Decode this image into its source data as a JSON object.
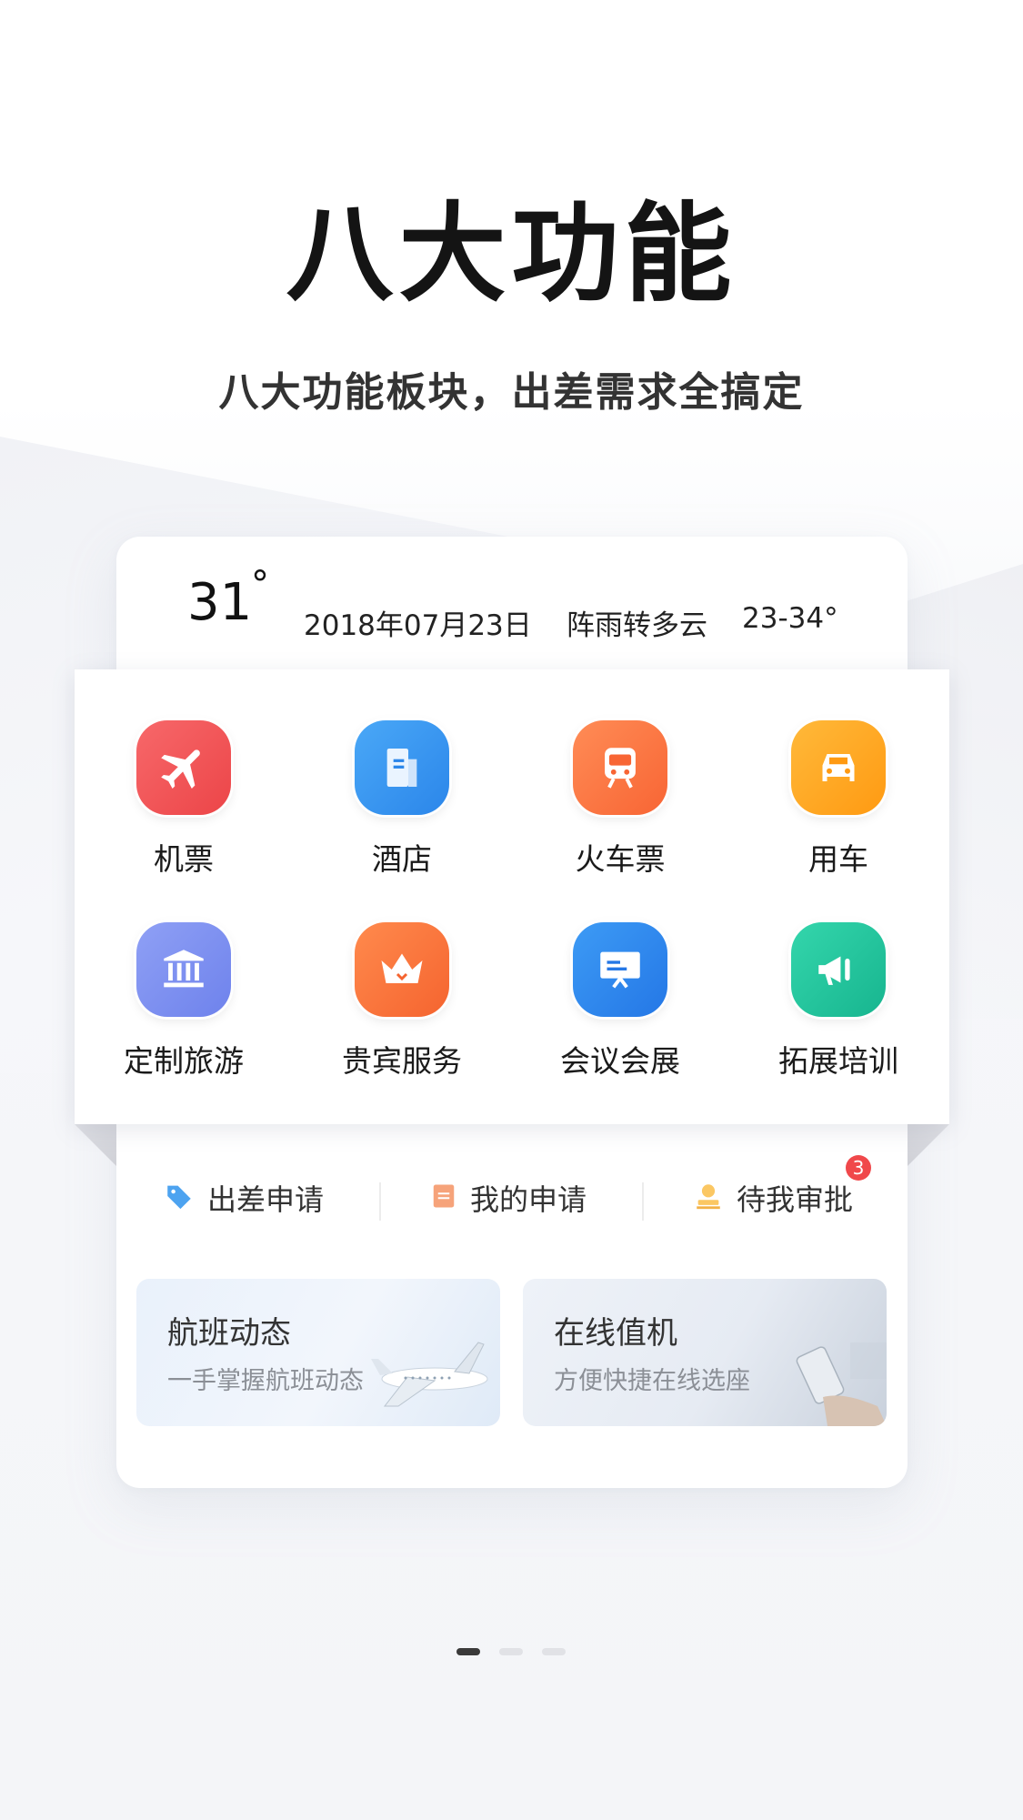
{
  "hero": {
    "title": "八大功能",
    "subtitle": "八大功能板块，出差需求全搞定"
  },
  "weather": {
    "temp": "31",
    "deg": "°",
    "date": "2018年07月23日",
    "condition": "阵雨转多云",
    "range": "23-34°"
  },
  "grid": [
    {
      "label": "机票",
      "icon": "plane-icon",
      "color": "#f05a5b"
    },
    {
      "label": "酒店",
      "icon": "hotel-icon",
      "color": "#3a96f2"
    },
    {
      "label": "火车票",
      "icon": "train-icon",
      "color": "#ff7a45"
    },
    {
      "label": "用车",
      "icon": "car-icon",
      "color": "#ffa51f"
    },
    {
      "label": "定制旅游",
      "icon": "museum-icon",
      "color": "#7b8ef0"
    },
    {
      "label": "贵宾服务",
      "icon": "crown-icon",
      "color": "#ff7b3f"
    },
    {
      "label": "会议会展",
      "icon": "presentation-icon",
      "color": "#2f8ef0"
    },
    {
      "label": "拓展培训",
      "icon": "megaphone-icon",
      "color": "#25c7a0"
    }
  ],
  "quick": {
    "apply": "出差申请",
    "mine": "我的申请",
    "approve": "待我审批",
    "badge": "3"
  },
  "promos": [
    {
      "title": "航班动态",
      "subtitle": "一手掌握航班动态"
    },
    {
      "title": "在线值机",
      "subtitle": "方便快捷在线选座"
    }
  ],
  "pager": {
    "count": 3,
    "active": 0
  }
}
